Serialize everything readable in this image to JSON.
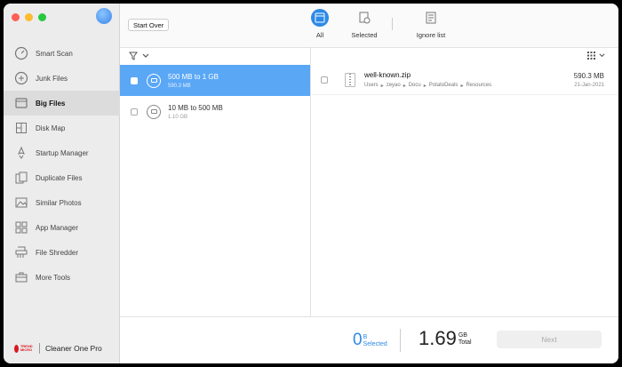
{
  "sidebar": {
    "items": [
      {
        "label": "Smart Scan",
        "icon": "gauge-icon"
      },
      {
        "label": "Junk Files",
        "icon": "junk-icon"
      },
      {
        "label": "Big Files",
        "icon": "big-files-icon",
        "active": true
      },
      {
        "label": "Disk Map",
        "icon": "disk-map-icon"
      },
      {
        "label": "Startup Manager",
        "icon": "startup-icon"
      },
      {
        "label": "Duplicate Files",
        "icon": "duplicate-icon"
      },
      {
        "label": "Similar Photos",
        "icon": "photos-icon"
      },
      {
        "label": "App Manager",
        "icon": "app-manager-icon"
      },
      {
        "label": "File Shredder",
        "icon": "shredder-icon"
      },
      {
        "label": "More Tools",
        "icon": "toolbox-icon"
      }
    ],
    "brand": {
      "logo_text": "TREND MICRO",
      "name": "Cleaner One Pro"
    }
  },
  "toolbar": {
    "start_over": "Start Over",
    "tabs": [
      {
        "label": "All",
        "active": true
      },
      {
        "label": "Selected"
      },
      {
        "label": "Ignore list"
      }
    ]
  },
  "groups": [
    {
      "title": "500 MB to 1 GB",
      "size": "590.3 MB",
      "selected": true
    },
    {
      "title": "10 MB to 500 MB",
      "size": "1.10 GB",
      "selected": false
    }
  ],
  "files": [
    {
      "name": "well-known.zip",
      "path": [
        "Users",
        "zeyao",
        "Docu",
        "PotatoDeals",
        "Resources"
      ],
      "size": "590.3 MB",
      "date": "21-Jan-2021"
    }
  ],
  "footer": {
    "selected_num": "0",
    "selected_unit": "B",
    "selected_label": "Selected",
    "total_num": "1.69",
    "total_unit": "GB",
    "total_label": "Total",
    "next": "Next"
  },
  "colors": {
    "accent": "#2d8ae6",
    "selected_row": "#5aa7f6"
  }
}
